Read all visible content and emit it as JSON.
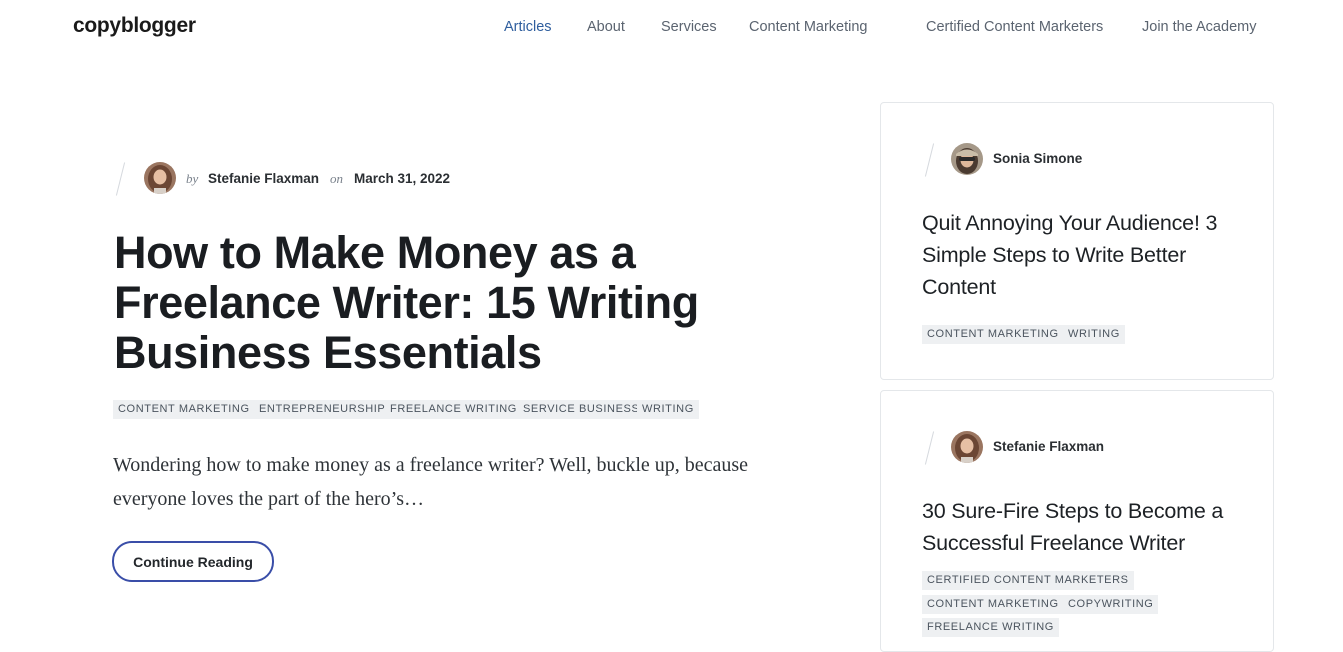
{
  "header": {
    "logo": "copyblogger",
    "nav": [
      {
        "label": "Articles",
        "active": true
      },
      {
        "label": "About"
      },
      {
        "label": "Services"
      },
      {
        "label": "Content Marketing"
      },
      {
        "label": "Certified Content Marketers"
      },
      {
        "label": "Join the Academy"
      }
    ]
  },
  "main": {
    "by": "by",
    "author": "Stefanie Flaxman",
    "on": "on",
    "date": "March 31, 2022",
    "title": "How to Make Money as a Freelance Writer: 15 Writing Business Essentials",
    "tags": [
      "CONTENT MARKETING",
      "ENTREPRENEURSHIP",
      "FREELANCE WRITING",
      "SERVICE BUSINESS",
      "WRITING"
    ],
    "excerpt": "Wondering how to make money as a freelance writer? Well, buckle up, because everyone loves the part of the hero’s…",
    "cta": "Continue Reading"
  },
  "sidebar": {
    "cards": [
      {
        "author": "Sonia Simone",
        "title": "Quit Annoying Your Audience! 3 Simple Steps to Write Better Content",
        "tags": [
          "CONTENT MARKETING",
          "WRITING"
        ]
      },
      {
        "author": "Stefanie Flaxman",
        "title": "30 Sure-Fire Steps to Become a Successful Freelance Writer",
        "tags": [
          "CERTIFIED CONTENT MARKETERS",
          "CONTENT MARKETING",
          "COPYWRITING",
          "FREELANCE WRITING"
        ]
      }
    ]
  },
  "colors": {
    "accent": "#2f5e9e",
    "button_border": "#3a4ea8",
    "tag_bg": "#eef0f2"
  }
}
